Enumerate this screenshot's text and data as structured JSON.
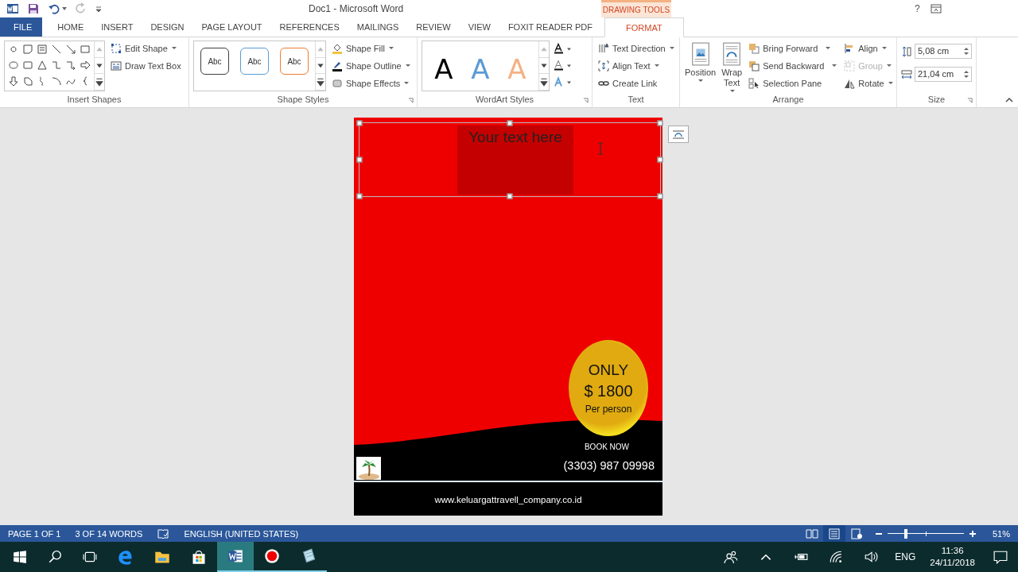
{
  "title_bar": {
    "title": "Doc1 - Microsoft Word",
    "contextual_header": "DRAWING TOOLS",
    "help": "?"
  },
  "tabs": [
    {
      "label": "FILE",
      "kind": "file",
      "selected": false
    },
    {
      "label": "HOME",
      "kind": "tab",
      "selected": false
    },
    {
      "label": "INSERT",
      "kind": "tab",
      "selected": false
    },
    {
      "label": "DESIGN",
      "kind": "tab",
      "selected": false
    },
    {
      "label": "PAGE LAYOUT",
      "kind": "tab",
      "selected": false
    },
    {
      "label": "REFERENCES",
      "kind": "tab",
      "selected": false
    },
    {
      "label": "MAILINGS",
      "kind": "tab",
      "selected": false
    },
    {
      "label": "REVIEW",
      "kind": "tab",
      "selected": false
    },
    {
      "label": "VIEW",
      "kind": "tab",
      "selected": false
    },
    {
      "label": "FOXIT READER PDF",
      "kind": "tab",
      "selected": false
    },
    {
      "label": "FORMAT",
      "kind": "contextual",
      "selected": true
    }
  ],
  "ribbon": {
    "insert_shapes": {
      "label": "Insert Shapes",
      "commands": [
        {
          "label": "Edit Shape",
          "dropdown": true
        },
        {
          "label": "Draw Text Box",
          "dropdown": false
        }
      ]
    },
    "shape_styles": {
      "label": "Shape Styles",
      "presets": [
        {
          "label": "Abc",
          "color": "#404040"
        },
        {
          "label": "Abc",
          "color": "#5b9bd5"
        },
        {
          "label": "Abc",
          "color": "#ed7d31"
        }
      ],
      "commands": [
        {
          "label": "Shape Fill",
          "dropdown": true
        },
        {
          "label": "Shape Outline",
          "dropdown": true
        },
        {
          "label": "Shape Effects",
          "dropdown": true
        }
      ]
    },
    "wordart_styles": {
      "label": "WordArt Styles",
      "presets": [
        {
          "label": "A",
          "color": "#000000"
        },
        {
          "label": "A",
          "color": "#5b9bd5"
        },
        {
          "label": "A",
          "color": "#f4b183"
        }
      ]
    },
    "text": {
      "label": "Text",
      "commands": [
        {
          "label": "Text Direction",
          "dropdown": true
        },
        {
          "label": "Align Text",
          "dropdown": true
        },
        {
          "label": "Create Link",
          "dropdown": false
        }
      ]
    },
    "arrange": {
      "label": "Arrange",
      "large": [
        {
          "label": "Position"
        },
        {
          "label": "Wrap Text"
        }
      ],
      "commands": [
        {
          "label": "Bring Forward",
          "dropdown": true,
          "disabled": false
        },
        {
          "label": "Send Backward",
          "dropdown": true,
          "disabled": false
        },
        {
          "label": "Selection Pane",
          "dropdown": false,
          "disabled": false
        },
        {
          "label": "Align",
          "dropdown": true,
          "disabled": false
        },
        {
          "label": "Group",
          "dropdown": true,
          "disabled": true
        },
        {
          "label": "Rotate",
          "dropdown": true,
          "disabled": false
        }
      ]
    },
    "size": {
      "label": "Size",
      "fields": [
        {
          "value": "5,08 cm"
        },
        {
          "value": "21,04 cm"
        }
      ]
    }
  },
  "document": {
    "text_box": {
      "text": "Your text here",
      "selected": true
    },
    "badge": {
      "lines": [
        "ONLY",
        "$ 1800",
        "Per person"
      ]
    },
    "book_label": "BOOK NOW",
    "phone": "(3303) 987 09998",
    "website": "www.keluargattravell_company.co.id"
  },
  "status_bar": {
    "items": [
      "PAGE 1 OF 1",
      "3 OF 14 WORDS"
    ],
    "language": "ENGLISH (UNITED STATES)",
    "views": [
      {
        "kind": "read",
        "selected": false
      },
      {
        "kind": "print",
        "selected": true
      },
      {
        "kind": "web",
        "selected": false
      }
    ],
    "zoom": {
      "level": 0.24,
      "reading": "51%"
    }
  },
  "taskbar": {
    "apps": [
      {
        "kind": "edge",
        "running": false,
        "active": false
      },
      {
        "kind": "explorer",
        "running": false,
        "active": false
      },
      {
        "kind": "store",
        "running": false,
        "active": false
      },
      {
        "kind": "word",
        "running": true,
        "active": true
      },
      {
        "kind": "recorder",
        "running": true,
        "active": false
      },
      {
        "kind": "notepad",
        "running": true,
        "active": false
      }
    ],
    "language": "ENG",
    "time": "11:36",
    "date": "24/11/2018"
  }
}
